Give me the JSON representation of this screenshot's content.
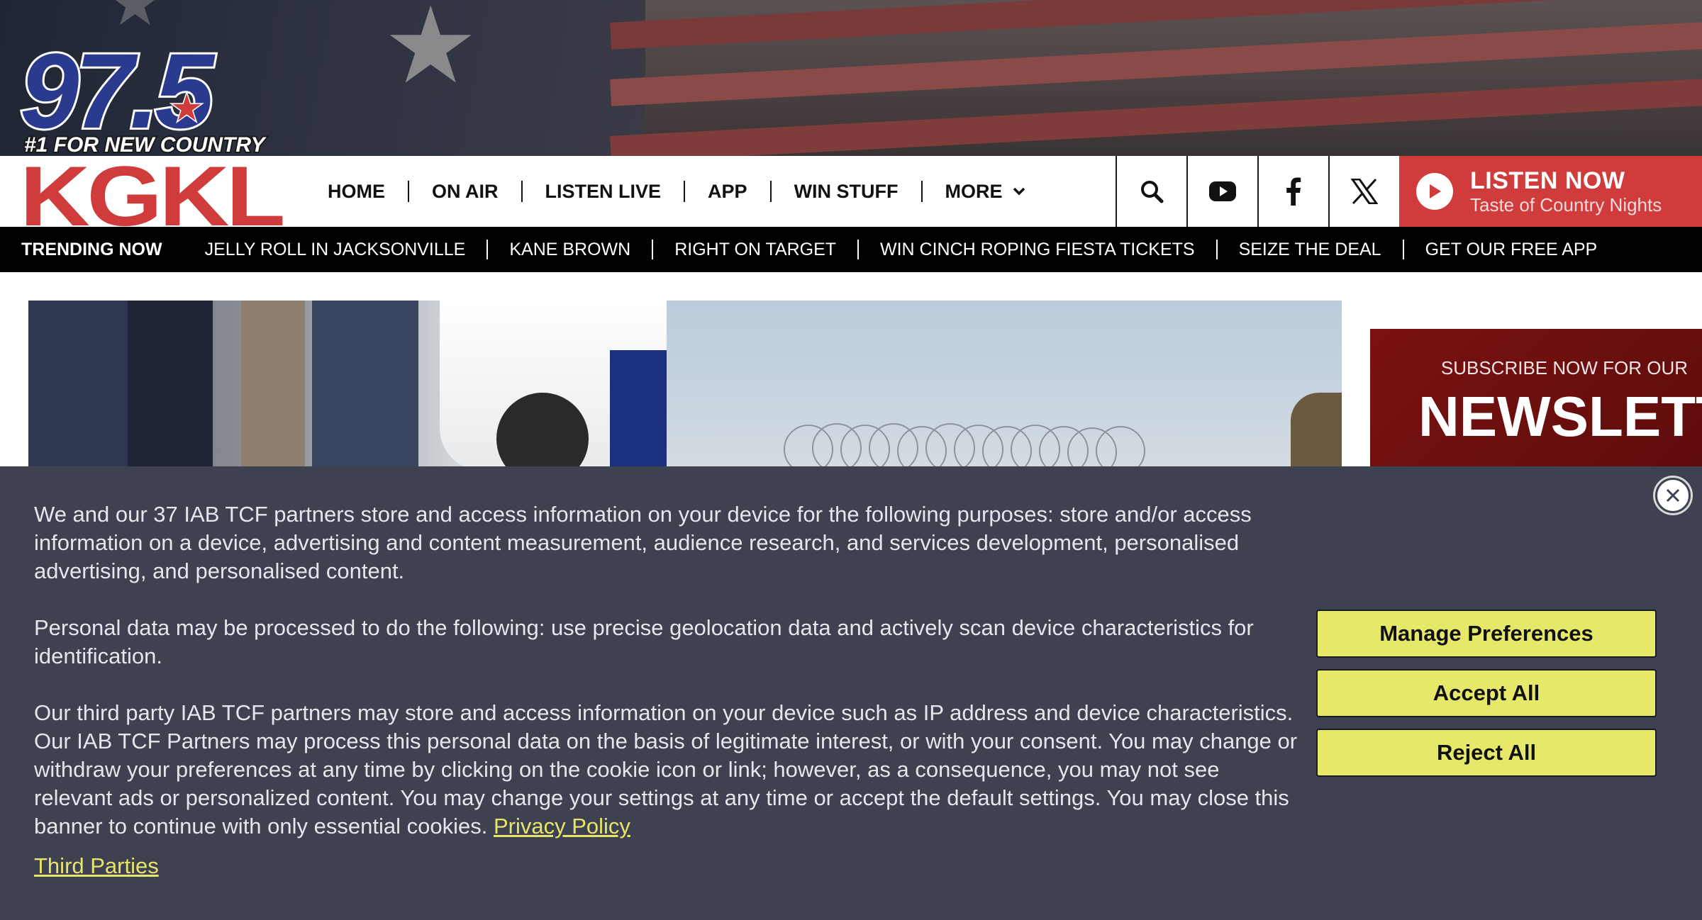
{
  "station": {
    "frequency": "97.5",
    "tagline": "#1 FOR NEW COUNTRY",
    "call_letters": "KGKL"
  },
  "nav": {
    "items": [
      "HOME",
      "ON AIR",
      "LISTEN LIVE",
      "APP",
      "WIN STUFF"
    ],
    "more_label": "MORE",
    "icons": [
      "search-icon",
      "youtube-icon",
      "facebook-icon",
      "x-icon"
    ]
  },
  "listen_now": {
    "title": "LISTEN NOW",
    "subtitle": "Taste of Country Nights"
  },
  "trending": {
    "label": "TRENDING NOW",
    "items": [
      "JELLY ROLL IN JACKSONVILLE",
      "KANE BROWN",
      "RIGHT ON TARGET",
      "WIN CINCH ROPING FIESTA TICKETS",
      "SEIZE THE DEAL",
      "GET OUR FREE APP"
    ]
  },
  "newsletter": {
    "subtitle": "SUBSCRIBE NOW FOR OUR",
    "title": "NEWSLETTE"
  },
  "cookie": {
    "para1": "We and our 37 IAB TCF partners store and access information on your device for the following purposes: store and/or access information on a device, advertising and content measurement, audience research, and services development, personalised advertising, and personalised content.",
    "para2": "Personal data may be processed to do the following: use precise geolocation data and actively scan device characteristics for identification.",
    "para3": "Our third party IAB TCF partners may store and access information on your device such as IP address and device characteristics. Our IAB TCF Partners may process this personal data on the basis of legitimate interest, or with your consent. You may change or withdraw your preferences at any time by clicking on the cookie icon or link; however, as a consequence, you may not see relevant ads or personalized content. You may change your settings at any time or accept the default settings. You may close this banner to continue with only essential cookies.",
    "privacy_link": "Privacy Policy",
    "third_parties_link": "Third Parties",
    "manage_label": "Manage Preferences",
    "accept_label": "Accept All",
    "reject_label": "Reject All"
  },
  "colors": {
    "brand_red": "#d03b3b",
    "logo_navy": "#2a3b8f",
    "banner_bg": "#3e4150",
    "button_yellow": "#e6e869"
  }
}
